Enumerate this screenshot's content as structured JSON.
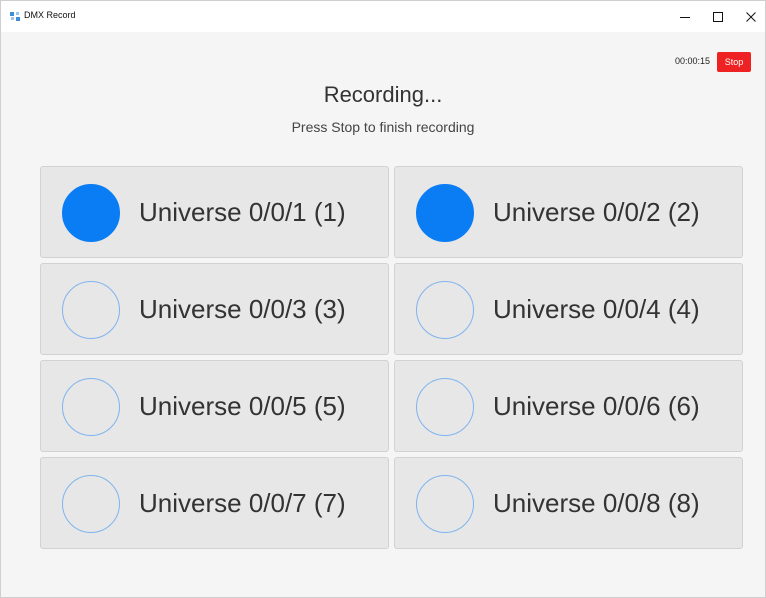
{
  "window": {
    "title": "DMX Record"
  },
  "recording": {
    "elapsed": "00:00:15",
    "stop_label": "Stop",
    "heading": "Recording...",
    "subheading": "Press Stop to finish recording"
  },
  "universes": [
    {
      "label": "Universe 0/0/1 (1)",
      "active": true
    },
    {
      "label": "Universe 0/0/2 (2)",
      "active": true
    },
    {
      "label": "Universe 0/0/3 (3)",
      "active": false
    },
    {
      "label": "Universe 0/0/4 (4)",
      "active": false
    },
    {
      "label": "Universe 0/0/5 (5)",
      "active": false
    },
    {
      "label": "Universe 0/0/6 (6)",
      "active": false
    },
    {
      "label": "Universe 0/0/7 (7)",
      "active": false
    },
    {
      "label": "Universe 0/0/8 (8)",
      "active": false
    }
  ],
  "colors": {
    "stop_button": "#ee2222",
    "active_indicator": "#0a7df5",
    "inactive_indicator_border": "#7fb4ef"
  }
}
